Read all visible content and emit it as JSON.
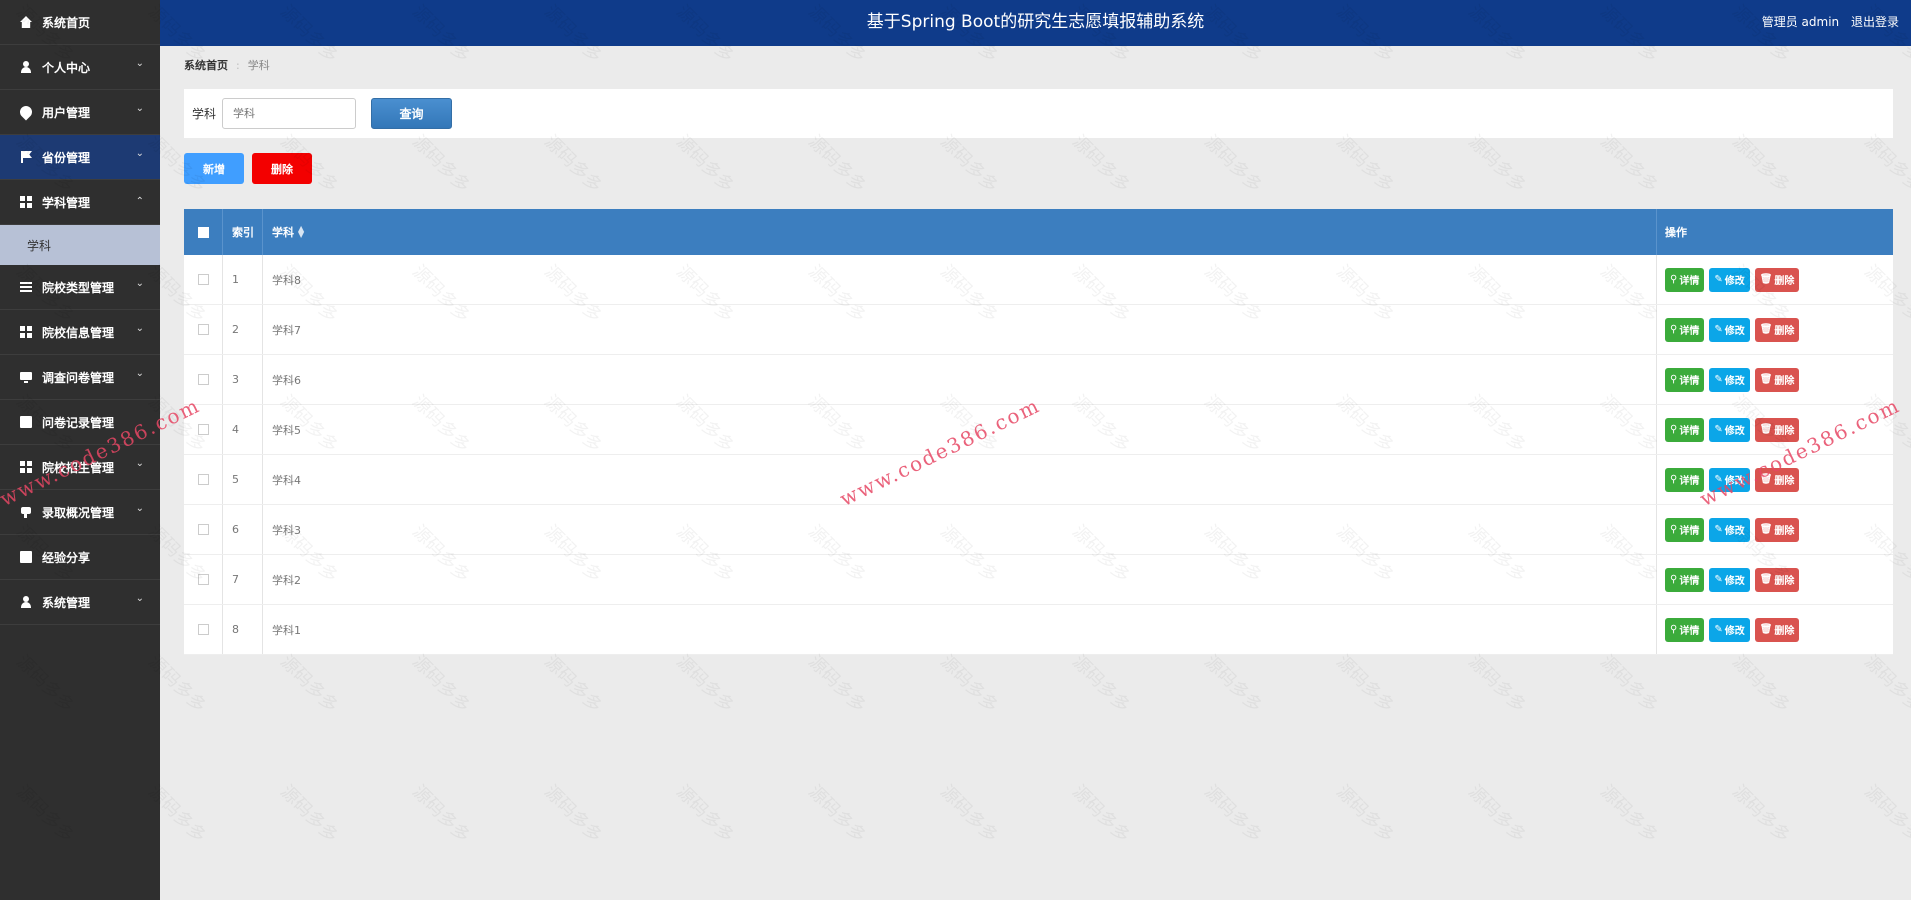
{
  "header": {
    "title": "基于Spring Boot的研究生志愿填报辅助系统",
    "user": "管理员 admin",
    "logout": "退出登录"
  },
  "sidebar": {
    "items": [
      {
        "label": "系统首页",
        "icon": "home-icon"
      },
      {
        "label": "个人中心",
        "icon": "user-icon"
      },
      {
        "label": "用户管理",
        "icon": "pin-icon"
      },
      {
        "label": "省份管理",
        "icon": "flag-icon"
      },
      {
        "label": "学科管理",
        "icon": "grid-icon"
      },
      {
        "label": "院校类型管理",
        "icon": "sliders-icon"
      },
      {
        "label": "院校信息管理",
        "icon": "grid-icon"
      },
      {
        "label": "调查问卷管理",
        "icon": "monitor-icon"
      },
      {
        "label": "问卷记录管理",
        "icon": "clipboard-icon"
      },
      {
        "label": "院校招生管理",
        "icon": "grid-icon"
      },
      {
        "label": "录取概况管理",
        "icon": "thumb-icon"
      },
      {
        "label": "经验分享",
        "icon": "clipboard-icon"
      },
      {
        "label": "系统管理",
        "icon": "user-icon"
      }
    ],
    "sub_item": "学科"
  },
  "breadcrumb": {
    "home": "系统首页",
    "current": "学科"
  },
  "search": {
    "label": "学科",
    "placeholder": "学科",
    "button": "查询"
  },
  "actions": {
    "add": "新增",
    "delete": "删除"
  },
  "table": {
    "columns": {
      "index": "索引",
      "name": "学科",
      "ops": "操作"
    },
    "rows": [
      {
        "index": "1",
        "name": "学科8"
      },
      {
        "index": "2",
        "name": "学科7"
      },
      {
        "index": "3",
        "name": "学科6"
      },
      {
        "index": "4",
        "name": "学科5"
      },
      {
        "index": "5",
        "name": "学科4"
      },
      {
        "index": "6",
        "name": "学科3"
      },
      {
        "index": "7",
        "name": "学科2"
      },
      {
        "index": "8",
        "name": "学科1"
      }
    ],
    "row_ops": {
      "detail": "详情",
      "edit": "修改",
      "delete": "删除"
    }
  },
  "watermark": {
    "text": "源码多多",
    "url": "www.code386.com"
  },
  "colors": {
    "header": "#0f3b8a",
    "sidebar": "#2f2f2f",
    "table_head": "#3c7ebf",
    "add": "#409eff",
    "delete": "#f30000"
  }
}
